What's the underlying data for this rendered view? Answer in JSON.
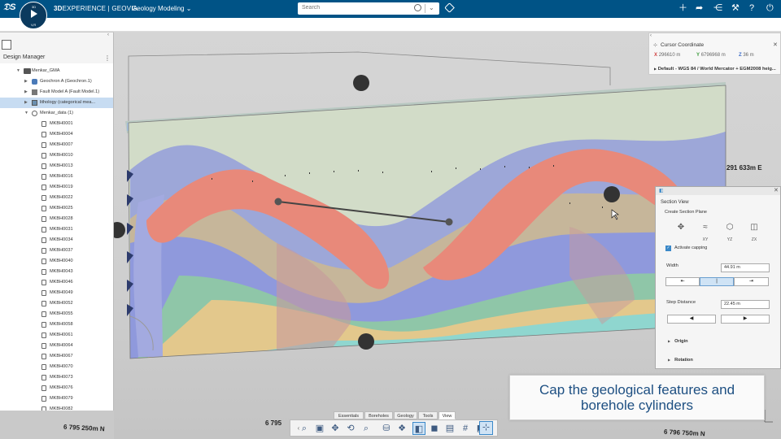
{
  "topbar": {
    "compass": {
      "north": "3D",
      "east": "",
      "south": "V,R"
    },
    "brand_prefix": "3D",
    "brand_main": "EXPERIENCE | GEOVIA",
    "app_name": "Geology Modeling",
    "app_chevron": "⌄",
    "search_placeholder": "Search",
    "right_icons": [
      "plus-icon",
      "share-arrow-icon",
      "network-icon",
      "tools-icon",
      "help-icon",
      "power-icon"
    ]
  },
  "design_manager": {
    "title": "Design Manager",
    "tree": [
      {
        "level": 0,
        "type": "root",
        "label": "Menkar_GMA",
        "expanded": true,
        "selected": false
      },
      {
        "level": 1,
        "type": "geo",
        "label": "Geochron A (Geochron.1)",
        "expanded": false,
        "selected": false
      },
      {
        "level": 1,
        "type": "fault",
        "label": "Fault Model A (Fault Model.1)",
        "expanded": false,
        "selected": false
      },
      {
        "level": 1,
        "type": "lith",
        "label": "lithology (categorical mea...",
        "expanded": false,
        "selected": true
      },
      {
        "level": 1,
        "type": "grp",
        "label": "Menkar_data (1)",
        "expanded": true,
        "selected": false
      },
      {
        "level": 2,
        "type": "bh",
        "label": "MKBH0001"
      },
      {
        "level": 2,
        "type": "bh",
        "label": "MKBH0004"
      },
      {
        "level": 2,
        "type": "bh",
        "label": "MKBH0007"
      },
      {
        "level": 2,
        "type": "bh",
        "label": "MKBH0010"
      },
      {
        "level": 2,
        "type": "bh",
        "label": "MKBH0013"
      },
      {
        "level": 2,
        "type": "bh",
        "label": "MKBH0016"
      },
      {
        "level": 2,
        "type": "bh",
        "label": "MKBH0019"
      },
      {
        "level": 2,
        "type": "bh",
        "label": "MKBH0022"
      },
      {
        "level": 2,
        "type": "bh",
        "label": "MKBH0025"
      },
      {
        "level": 2,
        "type": "bh",
        "label": "MKBH0028"
      },
      {
        "level": 2,
        "type": "bh",
        "label": "MKBH0031"
      },
      {
        "level": 2,
        "type": "bh",
        "label": "MKBH0034"
      },
      {
        "level": 2,
        "type": "bh",
        "label": "MKBH0037"
      },
      {
        "level": 2,
        "type": "bh",
        "label": "MKBH0040"
      },
      {
        "level": 2,
        "type": "bh",
        "label": "MKBH0043"
      },
      {
        "level": 2,
        "type": "bh",
        "label": "MKBH0046"
      },
      {
        "level": 2,
        "type": "bh",
        "label": "MKBH0049"
      },
      {
        "level": 2,
        "type": "bh",
        "label": "MKBH0052"
      },
      {
        "level": 2,
        "type": "bh",
        "label": "MKBH0055"
      },
      {
        "level": 2,
        "type": "bh",
        "label": "MKBH0058"
      },
      {
        "level": 2,
        "type": "bh",
        "label": "MKBH0061"
      },
      {
        "level": 2,
        "type": "bh",
        "label": "MKBH0064"
      },
      {
        "level": 2,
        "type": "bh",
        "label": "MKBH0067"
      },
      {
        "level": 2,
        "type": "bh",
        "label": "MKBH0070"
      },
      {
        "level": 2,
        "type": "bh",
        "label": "MKBH0073"
      },
      {
        "level": 2,
        "type": "bh",
        "label": "MKBH0076"
      },
      {
        "level": 2,
        "type": "bh",
        "label": "MKBH0079"
      },
      {
        "level": 2,
        "type": "bh",
        "label": "MKBH0082"
      }
    ]
  },
  "cursor_coordinate": {
    "title": "Cursor Coordinate",
    "x_label": "X",
    "x_value": "296610 m",
    "y_label": "Y",
    "y_value": "6796968 m",
    "z_label": "Z",
    "z_value": "36 m",
    "crs": "Default - WGS 84 / World Mercator + EGM2008 heig..."
  },
  "viewport_labels": {
    "east": "291 633m E",
    "north_left": "6 795 250m N",
    "north_mid": "6 795",
    "north_right": "6 796 750m N"
  },
  "section_view": {
    "title": "Section View",
    "create_label": "Create Section Plane",
    "plane_tools": [
      {
        "icon": "free-plane-icon",
        "label": ""
      },
      {
        "icon": "xy-plane-icon",
        "label": "XY"
      },
      {
        "icon": "yz-plane-icon",
        "label": "YZ"
      },
      {
        "icon": "zx-plane-icon",
        "label": "ZX"
      }
    ],
    "capping_label": "Activate capping",
    "width_label": "Width",
    "width_value": "44.91 m",
    "step_label": "Step Distance",
    "step_value": "22.45 m",
    "origin_label": "Origin",
    "rotation_label": "Rotation"
  },
  "caption": {
    "line1": "Cap the geological features and",
    "line2": "borehole cylinders"
  },
  "bottom_tabs": [
    "Essentials",
    "Boreholes",
    "Geology",
    "Tools",
    "View"
  ],
  "active_tab": "View",
  "colors": {
    "topbar": "#005386",
    "accent": "#3a88c8",
    "ore_body": "#e8897a",
    "caption_text": "#1d4f82"
  }
}
